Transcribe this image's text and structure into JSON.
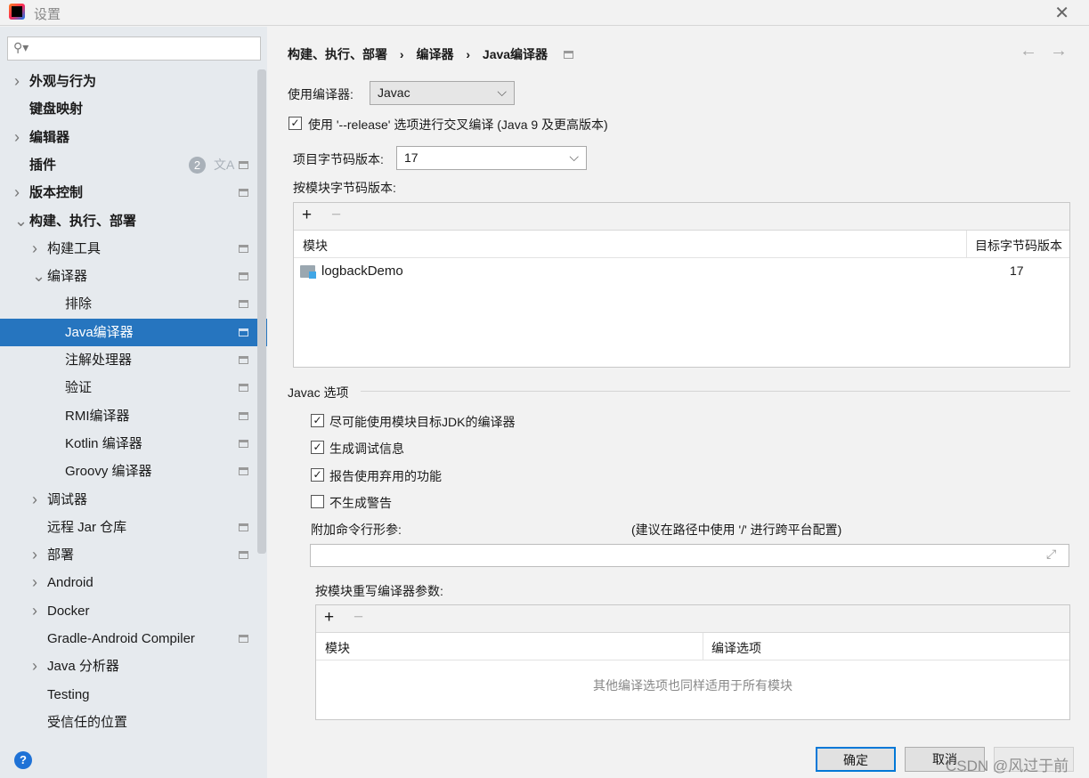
{
  "window": {
    "title": "设置"
  },
  "sidebar": {
    "items": [
      {
        "label": "外观与行为",
        "level": 0,
        "bold": true,
        "arrow": "right"
      },
      {
        "label": "键盘映射",
        "level": 0,
        "bold": true
      },
      {
        "label": "编辑器",
        "level": 0,
        "bold": true,
        "arrow": "right"
      },
      {
        "label": "插件",
        "level": 0,
        "bold": true,
        "badge": "2",
        "page": true
      },
      {
        "label": "版本控制",
        "level": 0,
        "bold": true,
        "arrow": "right",
        "page": true
      },
      {
        "label": "构建、执行、部署",
        "level": 0,
        "bold": true,
        "arrow": "down"
      },
      {
        "label": "构建工具",
        "level": 1,
        "arrow": "right",
        "page": true
      },
      {
        "label": "编译器",
        "level": 1,
        "arrow": "down",
        "page": true
      },
      {
        "label": "排除",
        "level": 2,
        "page": true
      },
      {
        "label": "Java编译器",
        "level": 2,
        "page": true,
        "selected": true
      },
      {
        "label": "注解处理器",
        "level": 2,
        "page": true
      },
      {
        "label": "验证",
        "level": 2,
        "page": true
      },
      {
        "label": "RMI编译器",
        "level": 2,
        "page": true
      },
      {
        "label": "Kotlin 编译器",
        "level": 2,
        "page": true
      },
      {
        "label": "Groovy 编译器",
        "level": 2,
        "page": true
      },
      {
        "label": "调试器",
        "level": 1,
        "arrow": "right"
      },
      {
        "label": "远程 Jar 仓库",
        "level": 1,
        "page": true
      },
      {
        "label": "部署",
        "level": 1,
        "arrow": "right",
        "page": true
      },
      {
        "label": "Android",
        "level": 1,
        "arrow": "right"
      },
      {
        "label": "Docker",
        "level": 1,
        "arrow": "right"
      },
      {
        "label": "Gradle-Android Compiler",
        "level": 1,
        "page": true
      },
      {
        "label": "Java 分析器",
        "level": 1,
        "arrow": "right"
      },
      {
        "label": "Testing",
        "level": 1
      },
      {
        "label": "受信任的位置",
        "level": 1
      }
    ],
    "translate_icon": "文A"
  },
  "breadcrumb": [
    "构建、执行、部署",
    "编译器",
    "Java编译器"
  ],
  "compiler": {
    "label": "使用编译器:",
    "value": "Javac"
  },
  "release": {
    "label": "使用 '--release' 选项进行交叉编译 (Java 9 及更高版本)",
    "checked": true
  },
  "bytecode": {
    "label": "项目字节码版本:",
    "value": "17"
  },
  "module_bytecode": {
    "label": "按模块字节码版本:",
    "col_module": "模块",
    "col_target": "目标字节码版本",
    "rows": [
      {
        "module": "logbackDemo",
        "target": "17"
      }
    ]
  },
  "javac": {
    "section": "Javac 选项",
    "options": [
      {
        "label": "尽可能使用模块目标JDK的编译器",
        "checked": true
      },
      {
        "label": "生成调试信息",
        "checked": true
      },
      {
        "label": "报告使用弃用的功能",
        "checked": true
      },
      {
        "label": "不生成警告",
        "checked": false
      }
    ],
    "args_label": "附加命令行形参:",
    "args_hint": "(建议在路径中使用 '/' 进行跨平台配置)",
    "args_value": ""
  },
  "override": {
    "label": "按模块重写编译器参数:",
    "col_module": "模块",
    "col_options": "编译选项",
    "empty": "其他编译选项也同样适用于所有模块"
  },
  "buttons": {
    "ok": "确定",
    "cancel": "取消"
  },
  "watermark": "CSDN @风过于前",
  "colors": {
    "selection": "#2675bf",
    "ok_border": "#0078d7"
  }
}
